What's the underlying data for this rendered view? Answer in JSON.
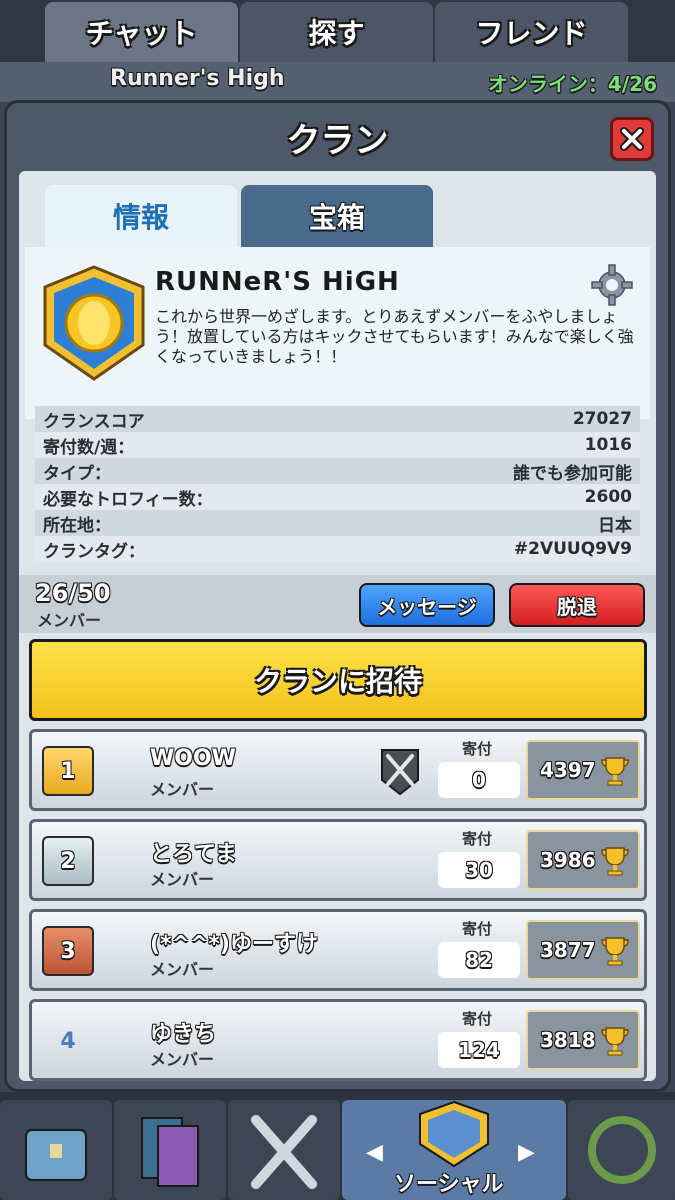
{
  "bg_tabs": [
    "チャット",
    "探す",
    "フレンド"
  ],
  "bg_strip": {
    "clan_name": "Runner's High",
    "online": "オンライン：4/26"
  },
  "modal": {
    "title": "クラン"
  },
  "sub_tabs": {
    "info": "情報",
    "chest": "宝箱"
  },
  "clan": {
    "name": "RUNNeR'S HiGH",
    "description": "これから世界一めざします。とりあえずメンバーをふやしましょう！放置している方はキックさせてもらいます！みんなで楽しく強くなっていきましょう！！"
  },
  "stats": [
    {
      "label": "クランスコア",
      "value": "27027"
    },
    {
      "label": "寄付数/週：",
      "value": "1016"
    },
    {
      "label": "タイプ：",
      "value": "誰でも参加可能"
    },
    {
      "label": "必要なトロフィー数：",
      "value": "2600"
    },
    {
      "label": "所在地：",
      "value": "日本"
    },
    {
      "label": "クランタグ：",
      "value": "#2VUUQ9V9"
    }
  ],
  "members_info": {
    "count": "26/50",
    "label": "メンバー"
  },
  "buttons": {
    "message": "メッセージ",
    "leave": "脱退",
    "invite": "クランに招待"
  },
  "donation_label": "寄付",
  "members": [
    {
      "rank": "1",
      "name": "WOOW",
      "role": "メンバー",
      "donations": "0",
      "trophies": "4397"
    },
    {
      "rank": "2",
      "name": "とろてま",
      "role": "メンバー",
      "donations": "30",
      "trophies": "3986"
    },
    {
      "rank": "3",
      "name": "(*^^*)ゆーすけ",
      "role": "メンバー",
      "donations": "82",
      "trophies": "3877"
    },
    {
      "rank": "4",
      "name": "ゆきち",
      "role": "メンバー",
      "donations": "124",
      "trophies": "3818"
    }
  ],
  "bottom_nav": {
    "active_label": "ソーシャル"
  },
  "colors": {
    "accent_blue": "#1e6fb8",
    "invite_yellow": "#f2c21b",
    "leave_red": "#d41e1e",
    "message_blue": "#1f6fdd"
  }
}
